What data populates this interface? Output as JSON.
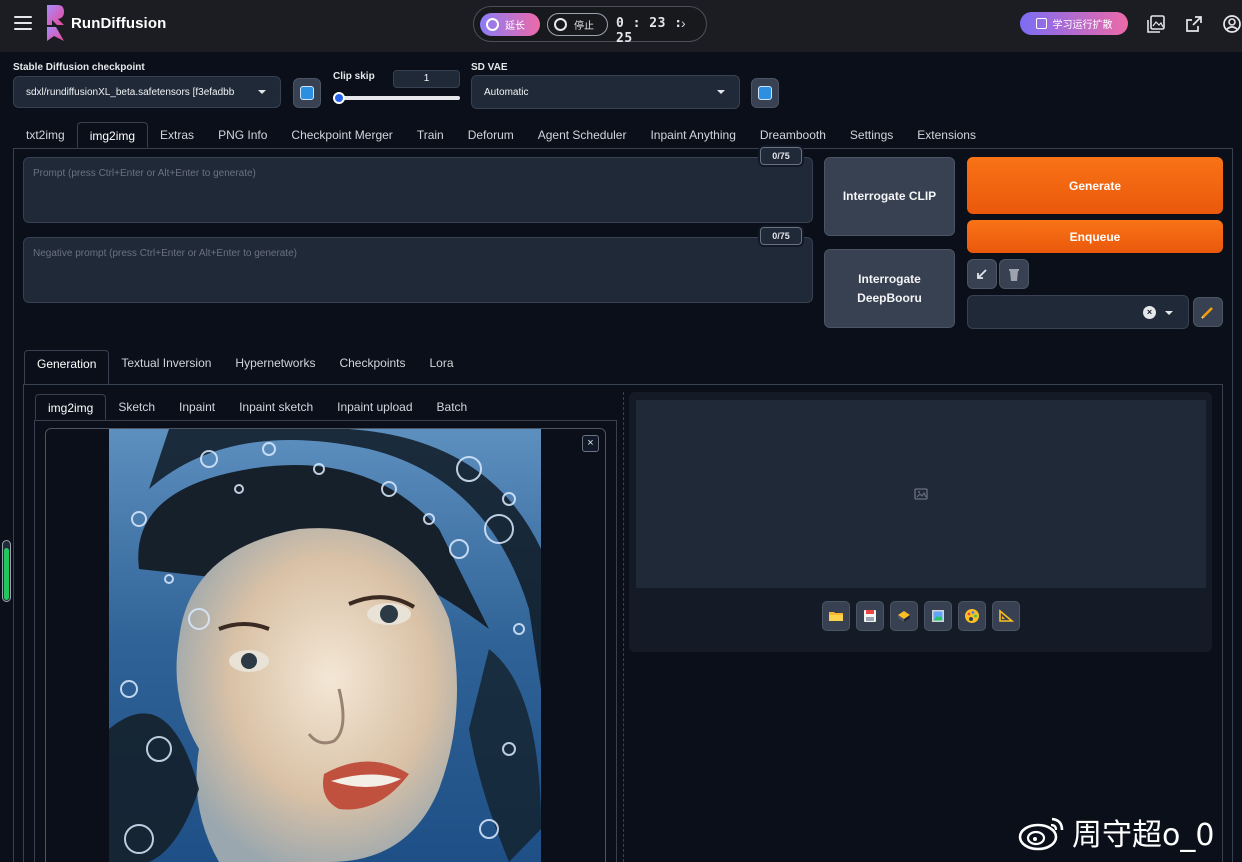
{
  "app": {
    "brand": "RunDiffusion"
  },
  "session": {
    "extend_label": "延长",
    "stop_label": "停止",
    "timer": "0 : 23 : 25",
    "chevron": "›"
  },
  "header": {
    "learn_label": "学习运行扩散"
  },
  "settings": {
    "checkpoint_label": "Stable Diffusion checkpoint",
    "checkpoint_value": "sdxl/rundiffusionXL_beta.safetensors [f3efadbb",
    "clip_skip_label": "Clip skip",
    "clip_skip_value": "1",
    "clip_skip_level": 1,
    "vae_label": "SD VAE",
    "vae_value": "Automatic"
  },
  "main_tabs": [
    {
      "label": "txt2img"
    },
    {
      "label": "img2img"
    },
    {
      "label": "Extras"
    },
    {
      "label": "PNG Info"
    },
    {
      "label": "Checkpoint Merger"
    },
    {
      "label": "Train"
    },
    {
      "label": "Deforum"
    },
    {
      "label": "Agent Scheduler"
    },
    {
      "label": "Inpaint Anything"
    },
    {
      "label": "Dreambooth"
    },
    {
      "label": "Settings"
    },
    {
      "label": "Extensions"
    }
  ],
  "active_main_tab": "img2img",
  "prompt": {
    "placeholder": "Prompt (press Ctrl+Enter or Alt+Enter to generate)",
    "token_count": "0/75"
  },
  "negative_prompt": {
    "placeholder": "Negative prompt (press Ctrl+Enter or Alt+Enter to generate)",
    "token_count": "0/75"
  },
  "buttons": {
    "interrogate_clip": "Interrogate CLIP",
    "interrogate_deepbooru_line1": "Interrogate",
    "interrogate_deepbooru_line2": "DeepBooru",
    "generate": "Generate",
    "enqueue": "Enqueue",
    "style_clear": "×"
  },
  "extra_tabs": [
    {
      "label": "Generation"
    },
    {
      "label": "Textual Inversion"
    },
    {
      "label": "Hypernetworks"
    },
    {
      "label": "Checkpoints"
    },
    {
      "label": "Lora"
    }
  ],
  "mode_tabs": [
    {
      "label": "img2img"
    },
    {
      "label": "Sketch"
    },
    {
      "label": "Inpaint"
    },
    {
      "label": "Inpaint sketch"
    },
    {
      "label": "Inpaint upload"
    },
    {
      "label": "Batch"
    }
  ],
  "image_close": "×",
  "output_buttons": [
    "folder-icon",
    "save-icon",
    "zip-icon",
    "send-to-img2img-icon",
    "send-to-inpaint-icon",
    "send-to-extras-icon"
  ],
  "colors": {
    "accent": "#f97316",
    "background": "#0b0f19",
    "panel": "#1f2937"
  },
  "progress": {
    "fraction": 0.9
  },
  "watermark": "周守超o_0"
}
